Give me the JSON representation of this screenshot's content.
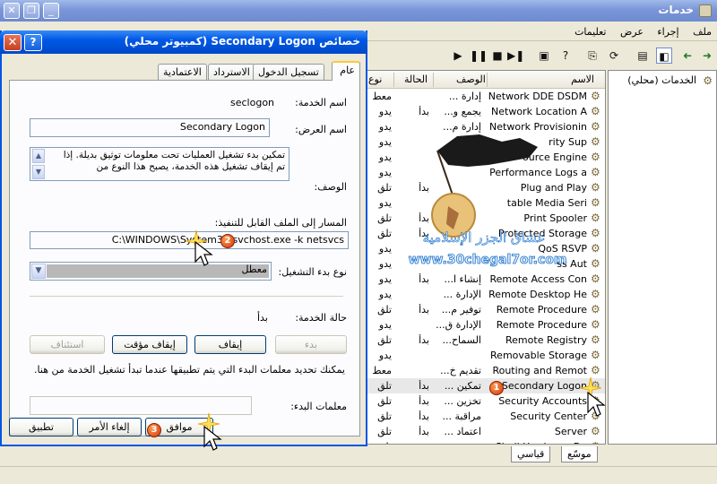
{
  "services_window": {
    "title": "خدمات",
    "menu": [
      "ملف",
      "إجراء",
      "عرض",
      "تعليمات"
    ],
    "tree_item": "الخدمات (محلي)",
    "columns": {
      "name": "الاسم",
      "description": "الوصف",
      "status": "الحالة",
      "startup": "نوع"
    },
    "rows": [
      {
        "name": "Network DDE DSDM",
        "desc": "إدارة ...",
        "status": "",
        "startup": "معط"
      },
      {
        "name": "Network Location A",
        "desc": "يجمع و...",
        "status": "بدأ",
        "startup": "يدو"
      },
      {
        "name": "Network Provisionin",
        "desc": "إدارة م...",
        "status": "",
        "startup": "يدو"
      },
      {
        "name": "rity Sup",
        "desc": "",
        "status": "",
        "startup": "يدو"
      },
      {
        "name": "ource Engine",
        "desc": "",
        "status": "",
        "startup": "يدو"
      },
      {
        "name": "Performance Logs a",
        "desc": "",
        "status": "",
        "startup": "يدو"
      },
      {
        "name": "Plug and Play",
        "desc": "",
        "status": "بدأ",
        "startup": "تلق"
      },
      {
        "name": "table Media Seri",
        "desc": "",
        "status": "",
        "startup": "يدو"
      },
      {
        "name": "Print Spooler",
        "desc": "",
        "status": "بدأ",
        "startup": "تلق"
      },
      {
        "name": "Protected Storage",
        "desc": "",
        "status": "بدأ",
        "startup": "تلق"
      },
      {
        "name": "QoS RSVP",
        "desc": "",
        "status": "",
        "startup": "يدو"
      },
      {
        "name": "ss Aut",
        "desc": "",
        "status": "",
        "startup": "يدو"
      },
      {
        "name": "Remote Access Con",
        "desc": "إنشاء ا...",
        "status": "بدأ",
        "startup": "يدو"
      },
      {
        "name": "Remote Desktop He",
        "desc": "الإدارة ...",
        "status": "",
        "startup": "يدو"
      },
      {
        "name": "Remote Procedure",
        "desc": "توفير م...",
        "status": "بدأ",
        "startup": "تلق"
      },
      {
        "name": "Remote Procedure",
        "desc": "الإدارة ق...",
        "status": "",
        "startup": "يدو"
      },
      {
        "name": "Remote Registry",
        "desc": "السماح...",
        "status": "بدأ",
        "startup": "تلق"
      },
      {
        "name": "Removable Storage",
        "desc": "",
        "status": "",
        "startup": "يدو"
      },
      {
        "name": "Routing and Remot",
        "desc": "تقديم خ...",
        "status": "",
        "startup": "معط"
      },
      {
        "name": "Secondary Logon",
        "desc": "تمكين ...",
        "status": "بدأ",
        "startup": "تلق"
      },
      {
        "name": "Security Accounts",
        "desc": "تخزين ...",
        "status": "بدأ",
        "startup": "تلق"
      },
      {
        "name": "Security Center",
        "desc": "مراقبة ...",
        "status": "بدأ",
        "startup": "تلق"
      },
      {
        "name": "Server",
        "desc": "اعتماد ...",
        "status": "بدأ",
        "startup": "تلق"
      },
      {
        "name": "Shell Hardware De",
        "desc": "",
        "status": "",
        "startup": "تلق"
      }
    ],
    "bottom_tabs": [
      "موسّع",
      "قياسي"
    ]
  },
  "watermark": {
    "text_ar": "عشاق الجزر الإسلامية",
    "url": "www.30chegal7or.com"
  },
  "dialog": {
    "title": "خصائص Secondary Logon (كمبيوتر محلي)",
    "tabs": [
      "عام",
      "تسجيل الدخول",
      "الاسترداد",
      "الاعتمادية"
    ],
    "service_name_label": "اسم الخدمة:",
    "service_name": "seclogon",
    "display_name_label": "اسم العرض:",
    "display_name": "Secondary Logon",
    "description_label": "الوصف:",
    "description": "تمكين بدء تشغيل العمليات تحت معلومات توثيق بديلة. إذا تم إيقاف تشغيل هذه الخدمة، يصبح هذا النوع من",
    "path_label": "المسار إلى الملف القابل للتنفيذ:",
    "path": "C:\\WINDOWS\\System32\\svchost.exe -k netsvcs",
    "startup_type_label": "نوع بدء التشغيل:",
    "startup_type_value": "معطل",
    "status_label": "حالة الخدمة:",
    "status_value": "بدأ",
    "btn_start": "بدء",
    "btn_stop": "إيقاف",
    "btn_pause": "إيقاف مؤقت",
    "btn_resume": "استئناف",
    "note": "يمكنك تحديد معلمات البدء التي يتم تطبيقها عندما تبدأ تشغيل الخدمة من هنا.",
    "start_params_label": "معلمات البدء:",
    "start_params_value": "",
    "btn_ok": "موافق",
    "btn_cancel": "إلغاء الأمر",
    "btn_apply": "تطبيق"
  },
  "markers": [
    "1",
    "2",
    "3"
  ]
}
